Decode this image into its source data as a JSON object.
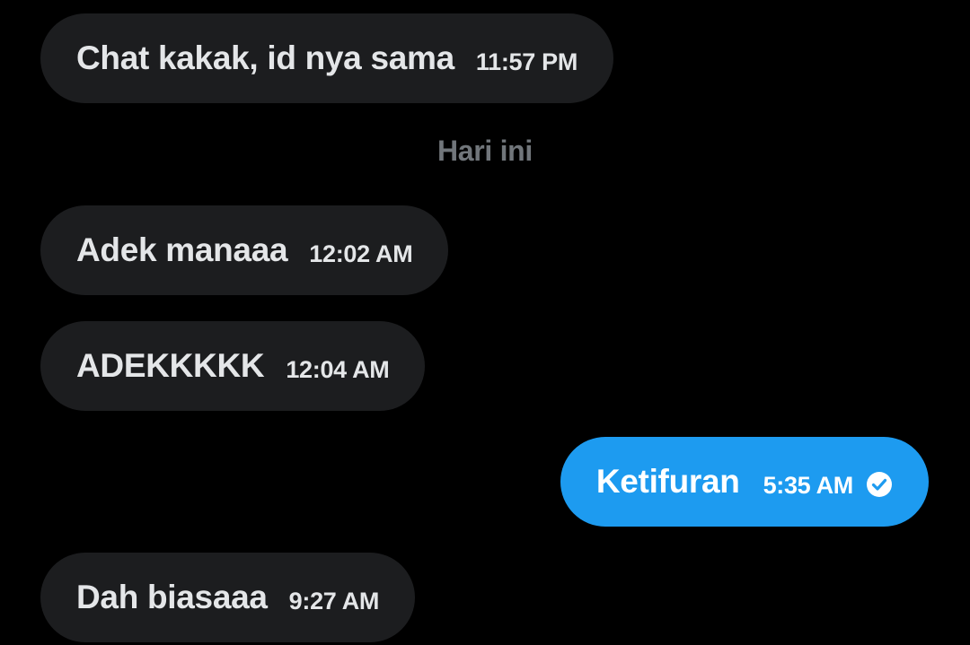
{
  "messages": [
    {
      "direction": "incoming",
      "text": "Chat kakak, id nya sama",
      "time": "11:57 PM"
    },
    {
      "direction": "incoming",
      "text": "Adek manaaa",
      "time": "12:02 AM"
    },
    {
      "direction": "incoming",
      "text": "ADEKKKKK",
      "time": "12:04 AM"
    },
    {
      "direction": "outgoing",
      "text": "Ketifuran",
      "time": "5:35 AM",
      "status_icon": "check-circle-icon"
    },
    {
      "direction": "incoming",
      "text": "Dah biasaaa",
      "time": "9:27 AM"
    }
  ],
  "date_divider": "Hari ini",
  "colors": {
    "background": "#000000",
    "incoming_bubble": "#1c1d1f",
    "outgoing_bubble": "#1d9bf0",
    "divider_text": "#71767b"
  }
}
